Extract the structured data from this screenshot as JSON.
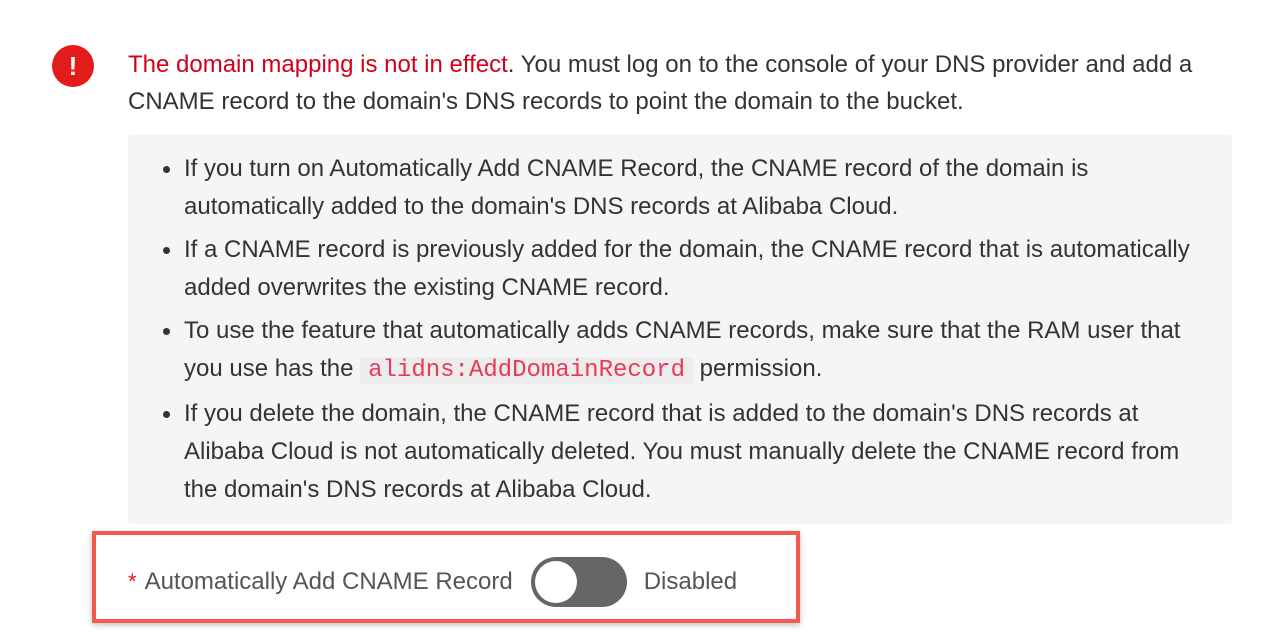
{
  "alert": {
    "icon": "exclamation-icon",
    "icon_glyph": "!",
    "color": "#e31b1b",
    "highlight_text": "The domain mapping is not in effect",
    "rest_text": ". You must log on to the console of your DNS provider and add a CNAME record to the domain's DNS records to point the domain to the bucket."
  },
  "notes": [
    {
      "text": "If you turn on Automatically Add CNAME Record, the CNAME record of the domain is automatically added to the domain's DNS records at Alibaba Cloud."
    },
    {
      "text": "If a CNAME record is previously added for the domain, the CNAME record that is automatically added overwrites the existing CNAME record."
    },
    {
      "before": "To use the feature that automatically adds CNAME records, make sure that the RAM user that you use has the ",
      "code": "alidns:AddDomainRecord",
      "after": " permission."
    },
    {
      "text": "If you delete the domain, the CNAME record that is added to the domain's DNS records at Alibaba Cloud is not automatically deleted. You must manually delete the CNAME record from the domain's DNS records at Alibaba Cloud."
    }
  ],
  "form": {
    "required_mark": "*",
    "label": "Automatically Add CNAME Record",
    "switch_on": false,
    "status": "Disabled"
  },
  "colors": {
    "highlight_border": "#f15a4f",
    "error_text": "#d0021b",
    "code_text": "#e8395d"
  }
}
